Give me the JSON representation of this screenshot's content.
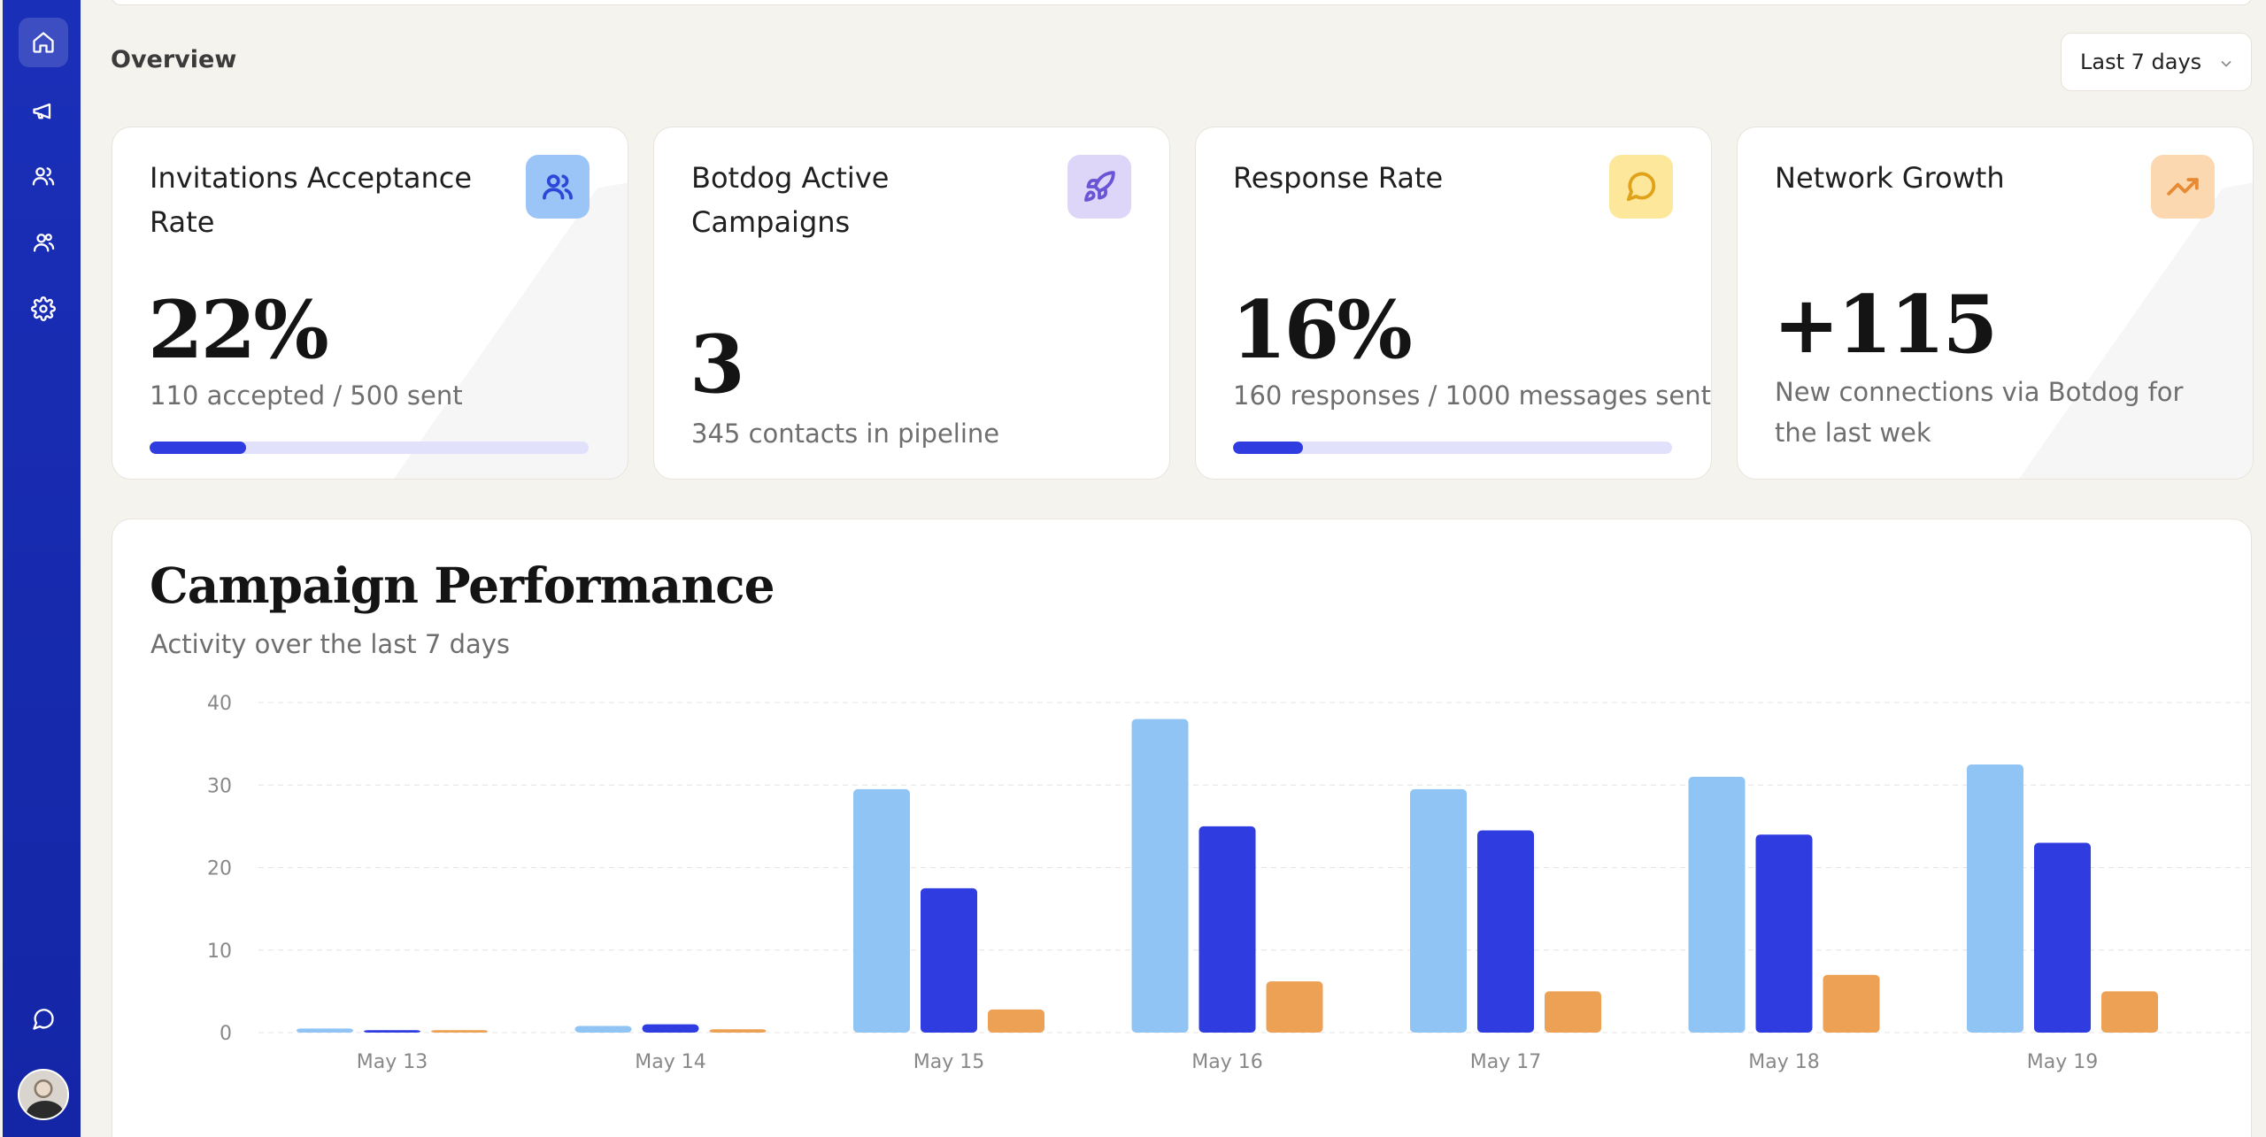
{
  "sidebar": {
    "items": [
      {
        "name": "home-icon",
        "active": true
      },
      {
        "name": "megaphone-icon",
        "active": false
      },
      {
        "name": "users-icon",
        "active": false
      },
      {
        "name": "contacts-icon",
        "active": false
      },
      {
        "name": "gear-icon",
        "active": false
      }
    ],
    "bottom": [
      {
        "name": "chat-icon"
      }
    ]
  },
  "overview": {
    "title": "Overview",
    "range": "Last 7 days"
  },
  "cards": [
    {
      "title": "Invitations Acceptance Rate",
      "value": "22%",
      "sub": "110 accepted / 500 sent",
      "progress": 0.22,
      "icon": "users-icon",
      "icon_bg": "#9cc5f7",
      "icon_color": "#2d47d9"
    },
    {
      "title": "Botdog Active Campaigns",
      "value": "3",
      "sub": "345 contacts in pipeline",
      "icon": "rocket-icon",
      "icon_bg": "#ddd6f8",
      "icon_color": "#6a55d6"
    },
    {
      "title": "Response Rate",
      "value": "16%",
      "sub": "160 responses / 1000 messages sent",
      "progress": 0.16,
      "icon": "message-circle-icon",
      "icon_bg": "#fde79b",
      "icon_color": "#e0a11b"
    },
    {
      "title": "Network Growth",
      "value": "+115",
      "sub": "New connections via Botdog for the last wek",
      "icon": "trending-up-icon",
      "icon_bg": "#fcd8b0",
      "icon_color": "#e88a34"
    }
  ],
  "performance": {
    "title": "Campaign Performance",
    "subtitle": "Activity over the last 7 days"
  },
  "chart_data": {
    "type": "bar",
    "categories": [
      "May 13",
      "May 14",
      "May 15",
      "May 16",
      "May 17",
      "May 18",
      "May 19"
    ],
    "series": [
      {
        "values": [
          0.5,
          0.8,
          29.5,
          38,
          29.5,
          31,
          32.5
        ],
        "color": "#8fc4f4"
      },
      {
        "values": [
          0.3,
          1,
          17.5,
          25,
          24.5,
          24,
          23
        ],
        "color": "#2f3de0"
      },
      {
        "values": [
          0.3,
          0.4,
          2.8,
          6.2,
          5,
          7,
          5
        ],
        "color": "#eca155"
      }
    ],
    "ylim": [
      0,
      40
    ],
    "yticks": [
      0,
      10,
      20,
      30,
      40
    ],
    "grid": true
  }
}
